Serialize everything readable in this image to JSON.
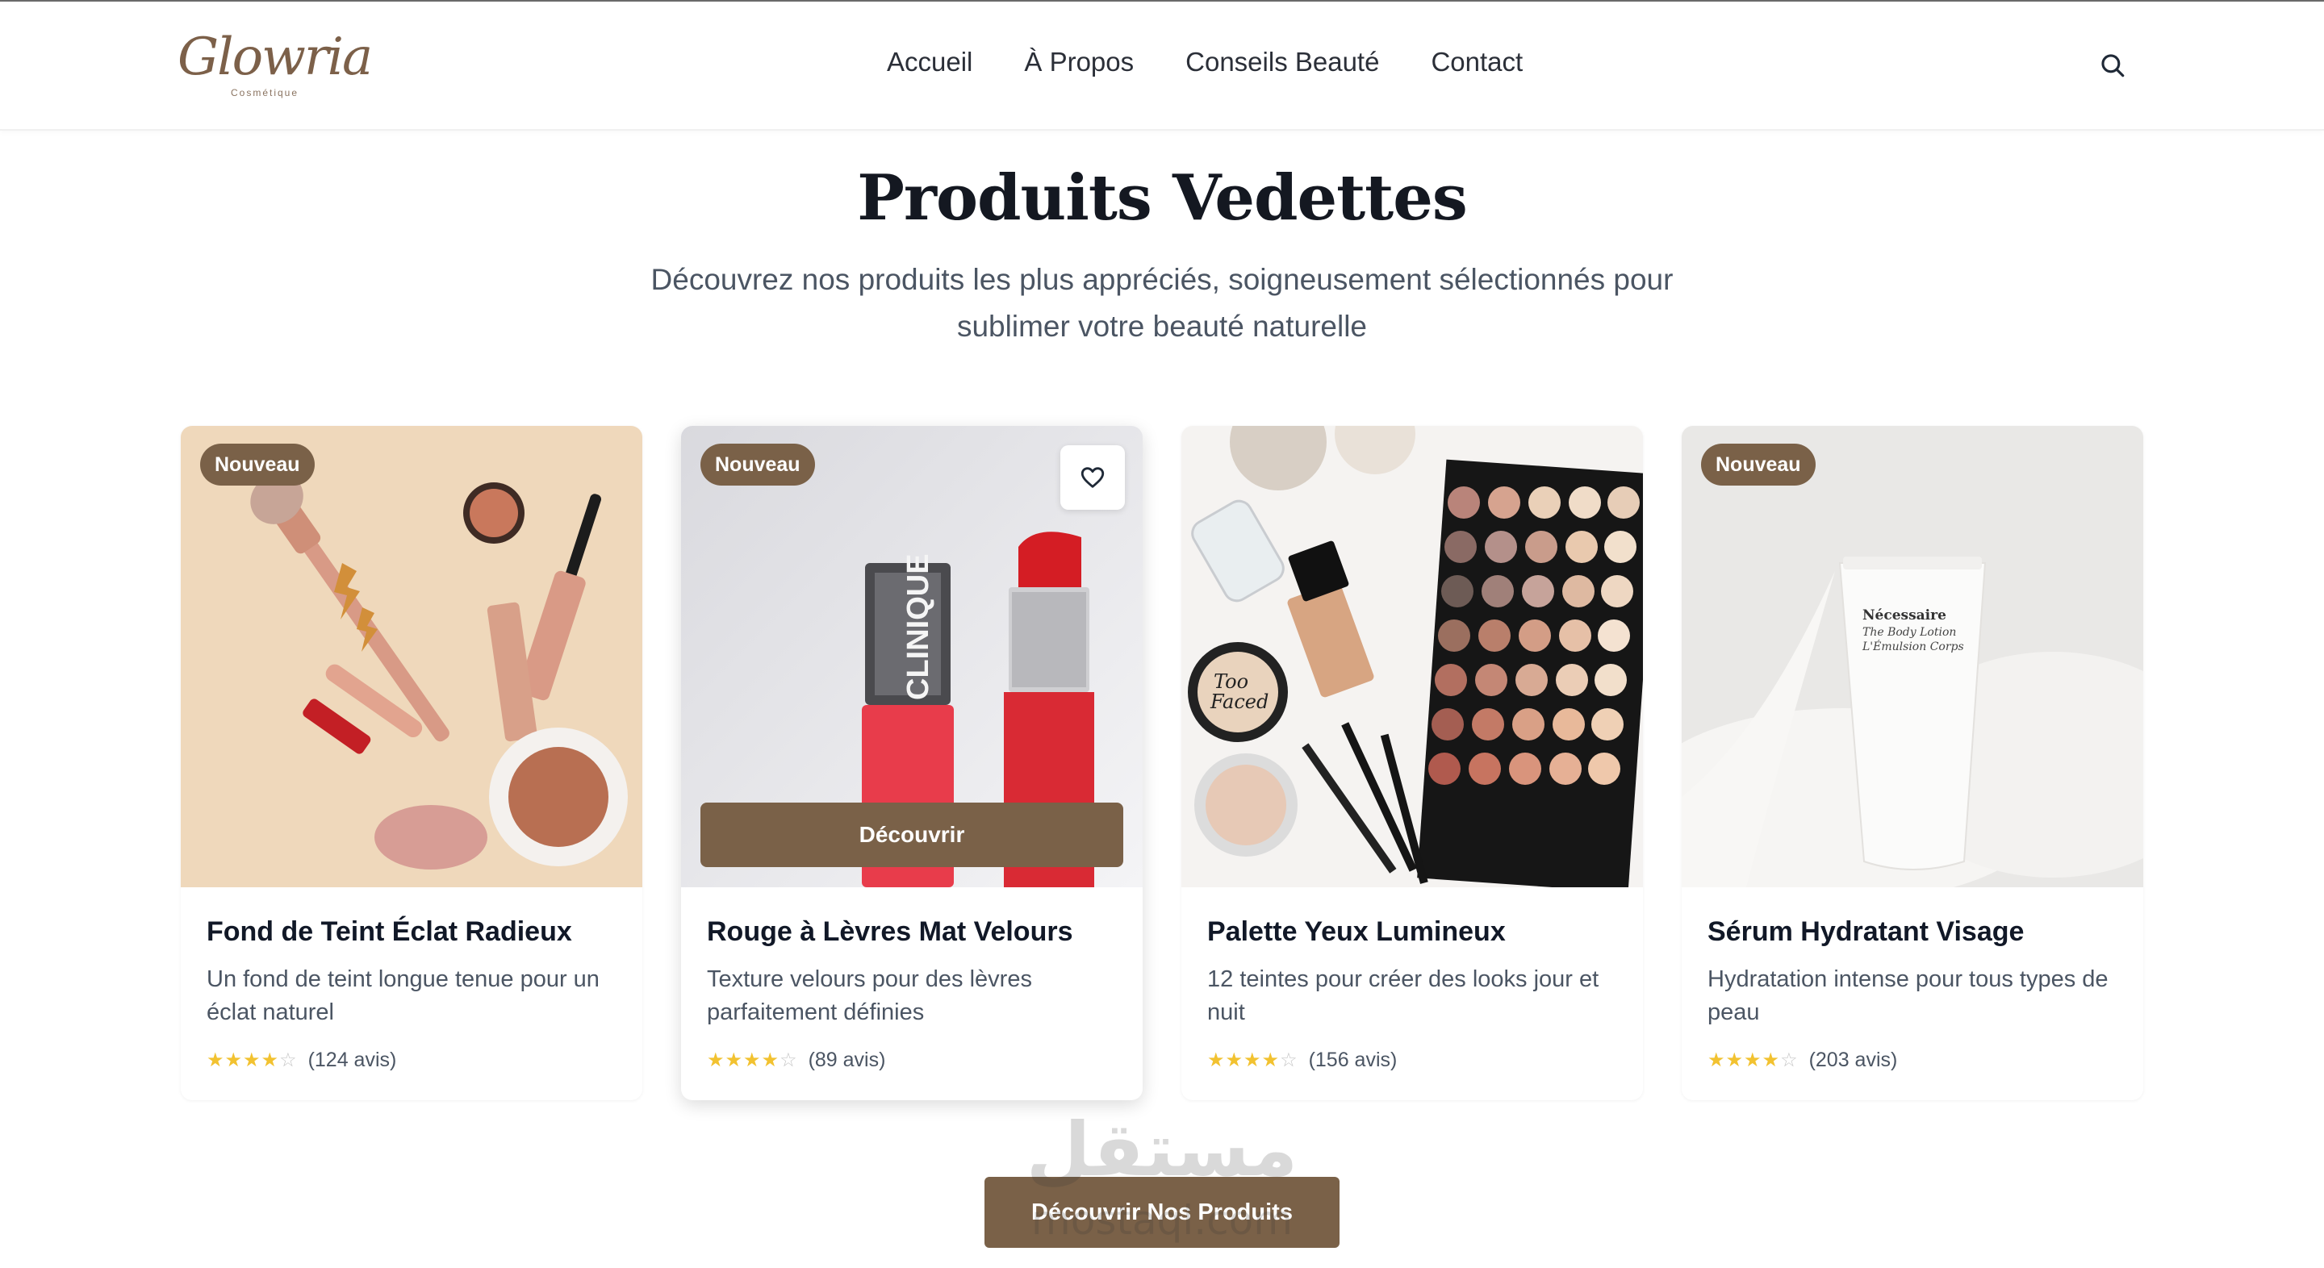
{
  "brand": {
    "logo_script": "Glowria",
    "logo_sub": "Cosmétique"
  },
  "nav": {
    "items": [
      {
        "label": "Accueil"
      },
      {
        "label": "À Propos"
      },
      {
        "label": "Conseils Beauté"
      },
      {
        "label": "Contact"
      }
    ]
  },
  "section": {
    "title": "Produits Vedettes",
    "subtitle": "Découvrez nos produits les plus appréciés, soigneusement sélectionnés pour sublimer votre beauté naturelle"
  },
  "products": [
    {
      "badge": "Nouveau",
      "name": "Fond de Teint Éclat Radieux",
      "description": "Un fond de teint longue tenue pour un éclat naturel",
      "rating": 4,
      "reviews": "(124 avis)"
    },
    {
      "badge": "Nouveau",
      "name": "Rouge à Lèvres Mat Velours",
      "description": "Texture velours pour des lèvres parfaitement définies",
      "rating": 4,
      "reviews": "(89 avis)",
      "button": "Découvrir"
    },
    {
      "badge": "",
      "name": "Palette Yeux Lumineux",
      "description": "12 teintes pour créer des looks jour et nuit",
      "rating": 4,
      "reviews": "(156 avis)"
    },
    {
      "badge": "Nouveau",
      "name": "Sérum Hydratant Visage",
      "description": "Hydratation intense pour tous types de peau",
      "rating": 4,
      "reviews": "(203 avis)"
    }
  ],
  "cta": {
    "label": "Découvrir Nos Produits"
  },
  "watermark": {
    "arabic": "مستقل",
    "latin": "mostaql.com"
  },
  "colors": {
    "accent": "#7a6148",
    "star": "#f2c230"
  },
  "icons": {
    "search": "search-icon",
    "favorite": "heart-icon"
  }
}
